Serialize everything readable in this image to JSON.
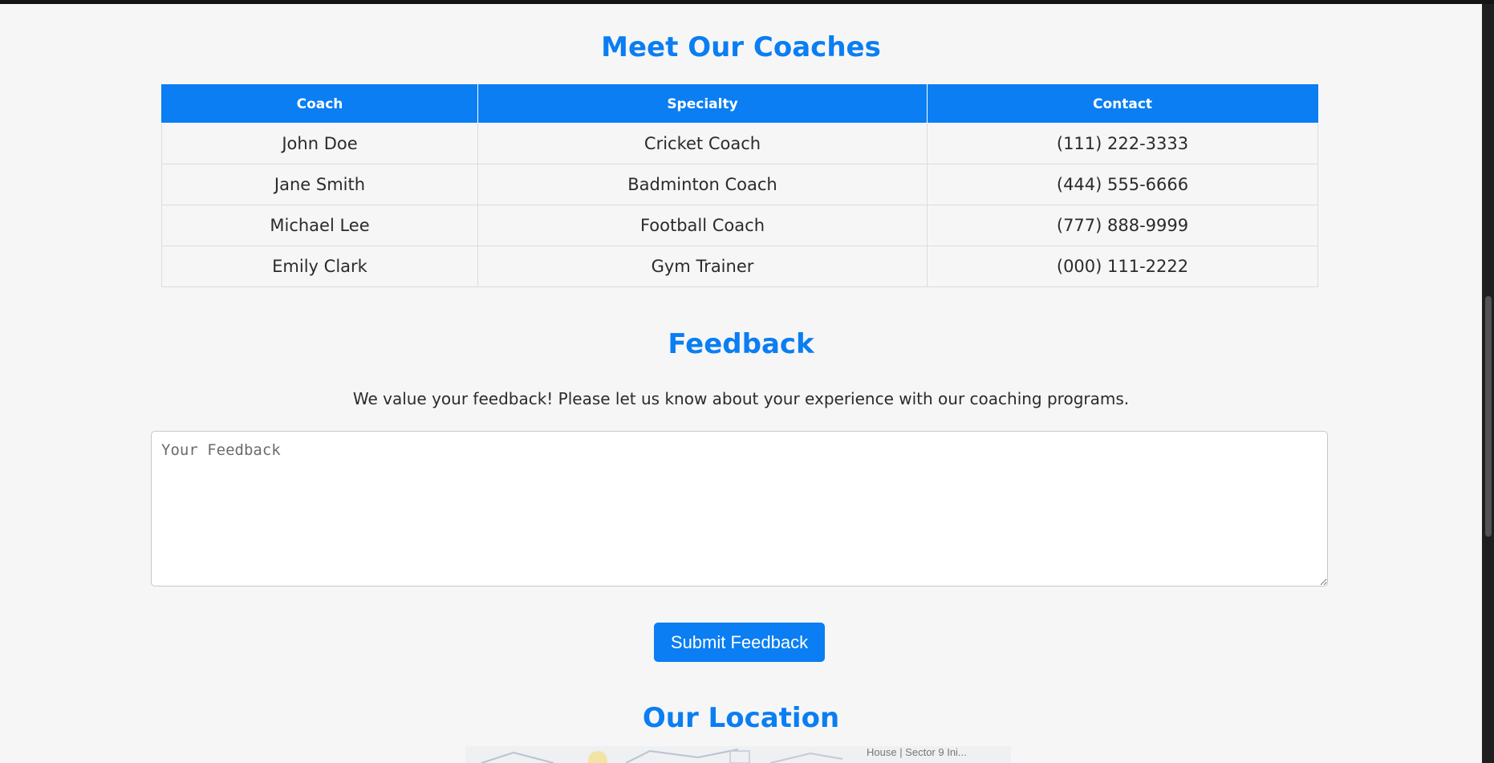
{
  "coaches": {
    "title": "Meet Our Coaches",
    "columns": [
      "Coach",
      "Specialty",
      "Contact"
    ],
    "rows": [
      {
        "coach": "John Doe",
        "specialty": "Cricket Coach",
        "contact": "(111) 222-3333"
      },
      {
        "coach": "Jane Smith",
        "specialty": "Badminton Coach",
        "contact": "(444) 555-6666"
      },
      {
        "coach": "Michael Lee",
        "specialty": "Football Coach",
        "contact": "(777) 888-9999"
      },
      {
        "coach": "Emily Clark",
        "specialty": "Gym Trainer",
        "contact": "(000) 111-2222"
      }
    ]
  },
  "feedback": {
    "title": "Feedback",
    "intro": "We value your feedback! Please let us know about your experience with our coaching programs.",
    "placeholder": "Your Feedback",
    "submit_label": "Submit Feedback"
  },
  "location": {
    "title": "Our Location",
    "map_label": "House | Sector 9 Ini..."
  },
  "colors": {
    "accent": "#0a7ef2",
    "background": "#f6f6f6"
  }
}
